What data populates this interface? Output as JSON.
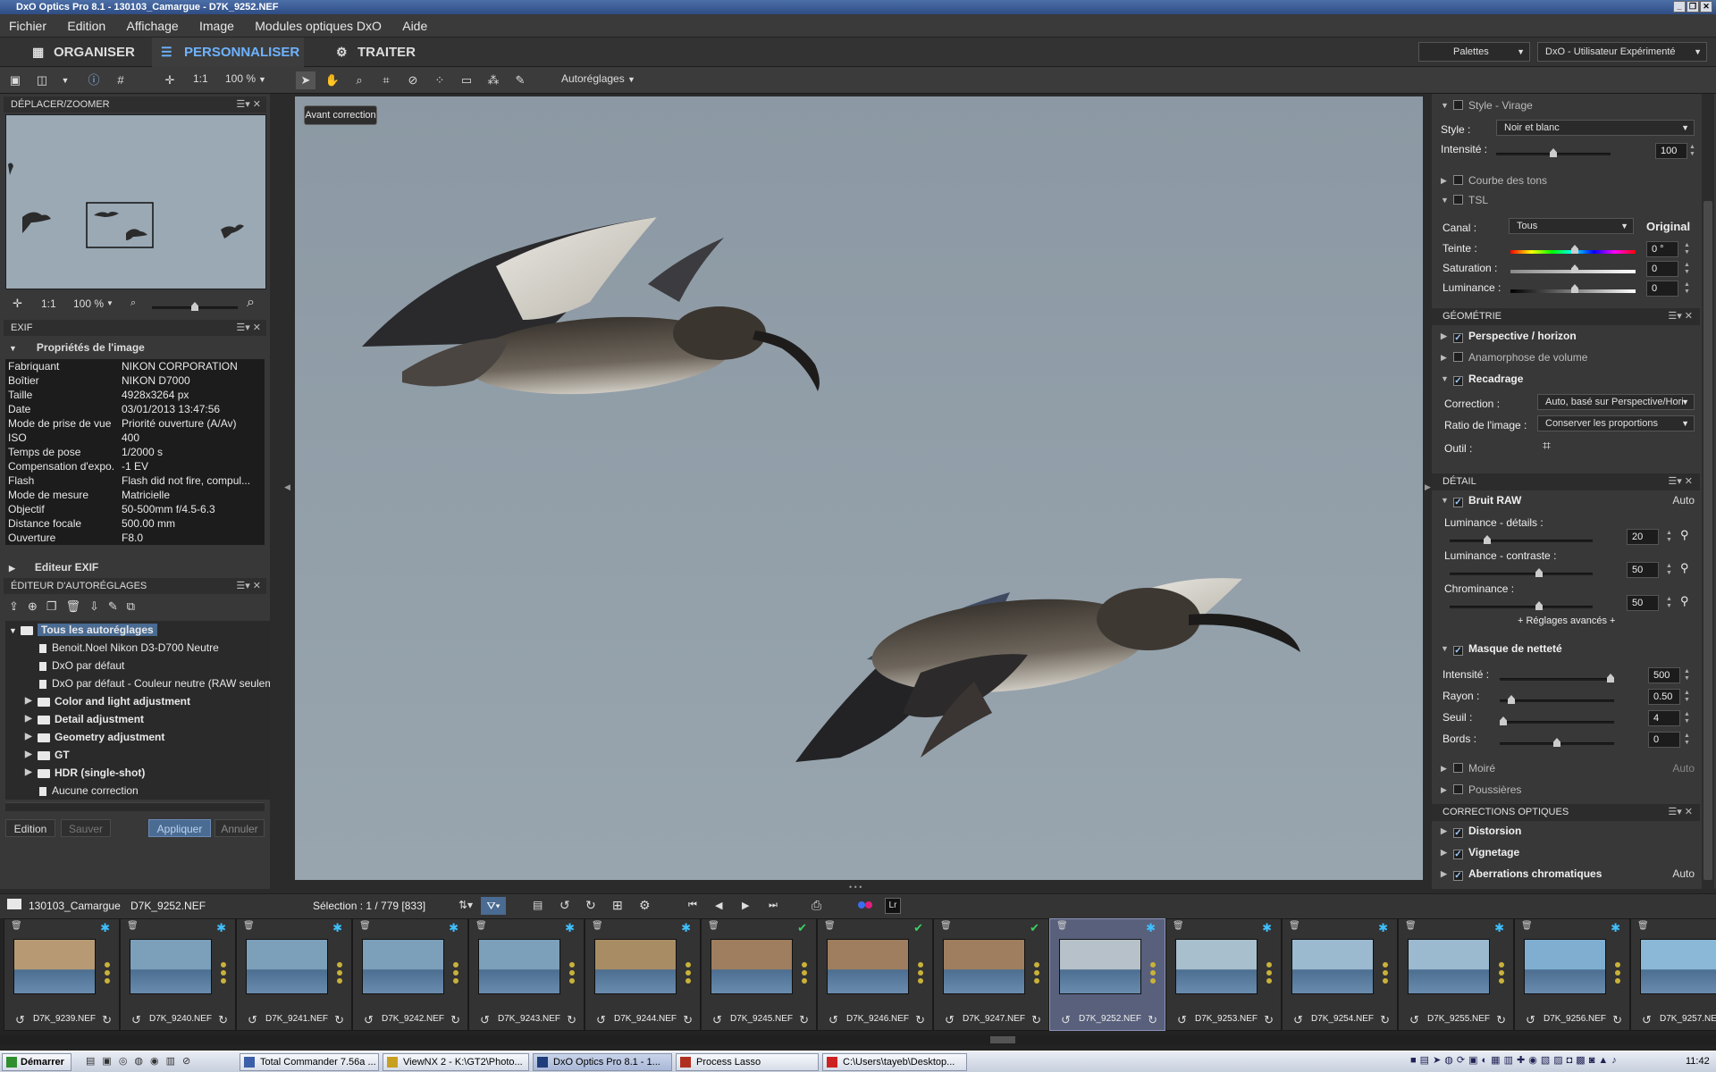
{
  "window": {
    "title": "DxO Optics Pro 8.1 - 130103_Camargue - D7K_9252.NEF"
  },
  "menu": [
    "Fichier",
    "Edition",
    "Affichage",
    "Image",
    "Modules optiques DxO",
    "Aide"
  ],
  "modes": {
    "organize": "ORGANISER",
    "customize": "PERSONNALISER",
    "process": "TRAITER"
  },
  "palettes": {
    "label": "Palettes",
    "workspace": "DxO - Utilisateur Expérimenté"
  },
  "toolbar": {
    "one_to_one": "1:1",
    "zoom": "100 %",
    "presets": "Autoréglages"
  },
  "viewer": {
    "before_button": "Avant correction"
  },
  "move_zoom": {
    "title": "DÉPLACER/ZOOMER",
    "one_to_one": "1:1",
    "zoom": "100 %"
  },
  "exif": {
    "title": "EXIF",
    "section": "Propriétés de l'image",
    "rows": [
      {
        "k": "Fabriquant",
        "v": "NIKON CORPORATION"
      },
      {
        "k": "Boîtier",
        "v": "NIKON D7000"
      },
      {
        "k": "Taille",
        "v": "4928x3264 px"
      },
      {
        "k": "Date",
        "v": "03/01/2013 13:47:56"
      },
      {
        "k": "Mode de prise de vue",
        "v": "Priorité ouverture (A/Av)"
      },
      {
        "k": "ISO",
        "v": "400"
      },
      {
        "k": "Temps de pose",
        "v": "1/2000 s"
      },
      {
        "k": "Compensation d'expo.",
        "v": "-1 EV"
      },
      {
        "k": "Flash",
        "v": "Flash did not fire, compul..."
      },
      {
        "k": "Mode de mesure",
        "v": "Matricielle"
      },
      {
        "k": "Objectif",
        "v": "50-500mm f/4.5-6.3"
      },
      {
        "k": "Distance focale",
        "v": "500.00 mm"
      },
      {
        "k": "Ouverture",
        "v": "F8.0"
      }
    ],
    "editor": "Editeur EXIF"
  },
  "presets_editor": {
    "title": "ÉDITEUR D'AUTORÉGLAGES",
    "root": "Tous les autoréglages",
    "items": [
      {
        "label": "Benoit.Noel Nikon D3-D700 Neutre",
        "type": "doc",
        "bold": false
      },
      {
        "label": "DxO par défaut",
        "type": "doc",
        "bold": false
      },
      {
        "label": "DxO par défaut - Couleur neutre (RAW seulem",
        "type": "doc",
        "bold": false
      },
      {
        "label": "Color and light adjustment",
        "type": "folder",
        "bold": true
      },
      {
        "label": "Detail adjustment",
        "type": "folder",
        "bold": true
      },
      {
        "label": "Geometry adjustment",
        "type": "folder",
        "bold": true
      },
      {
        "label": "GT",
        "type": "folder",
        "bold": true
      },
      {
        "label": "HDR (single-shot)",
        "type": "folder",
        "bold": true
      },
      {
        "label": "Aucune correction",
        "type": "doc",
        "bold": false
      }
    ],
    "buttons": {
      "edit": "Edition",
      "save": "Sauver",
      "apply": "Appliquer",
      "cancel": "Annuler"
    }
  },
  "right": {
    "style_virage": "Style - Virage",
    "style_label": "Style :",
    "style_value": "Noir et blanc",
    "intensity_label": "Intensité :",
    "intensity_value": "100",
    "tone_curve": "Courbe des tons",
    "tsl": "TSL",
    "channel_label": "Canal :",
    "channel_value": "Tous",
    "original": "Original",
    "hue_label": "Teinte :",
    "hue_value": "0 °",
    "sat_label": "Saturation :",
    "sat_value": "0",
    "lum_label": "Luminance :",
    "lum_value": "0",
    "geometry": "GÉOMÉTRIE",
    "perspective": "Perspective / horizon",
    "anamorphosis": "Anamorphose de volume",
    "crop": "Recadrage",
    "correction_label": "Correction :",
    "correction_value": "Auto, basé sur Perspective/Hori",
    "ratio_label": "Ratio de l'image :",
    "ratio_value": "Conserver les proportions",
    "tool_label": "Outil :",
    "detail": "DÉTAIL",
    "raw_noise": "Bruit RAW",
    "auto": "Auto",
    "lum_detail_label": "Luminance - détails :",
    "lum_detail_value": "20",
    "lum_contrast_label": "Luminance - contraste :",
    "lum_contrast_value": "50",
    "chroma_label": "Chrominance :",
    "chroma_value": "50",
    "advanced": "+ Réglages avancés +",
    "unsharp": "Masque de netteté",
    "us_int_label": "Intensité :",
    "us_int_value": "500",
    "radius_label": "Rayon :",
    "radius_value": "0.50",
    "threshold_label": "Seuil :",
    "threshold_value": "4",
    "edges_label": "Bords :",
    "edges_value": "0",
    "moire": "Moiré",
    "dust": "Poussières",
    "optical": "CORRECTIONS OPTIQUES",
    "distortion": "Distorsion",
    "vignetting": "Vignetage",
    "chromatic": "Aberrations chromatiques"
  },
  "status": {
    "folder": "130103_Camargue",
    "file": "D7K_9252.NEF",
    "selection": "Sélection : 1 / 779 [833]",
    "lr": "Lr"
  },
  "filmstrip": [
    {
      "name": "D7K_9239.NEF",
      "mark": "star",
      "tone": "#b79a74"
    },
    {
      "name": "D7K_9240.NEF",
      "mark": "star",
      "tone": "#7c9fba"
    },
    {
      "name": "D7K_9241.NEF",
      "mark": "star",
      "tone": "#7c9fba"
    },
    {
      "name": "D7K_9242.NEF",
      "mark": "star",
      "tone": "#7c9fba"
    },
    {
      "name": "D7K_9243.NEF",
      "mark": "star",
      "tone": "#7c9fba"
    },
    {
      "name": "D7K_9244.NEF",
      "mark": "star",
      "tone": "#a88d64"
    },
    {
      "name": "D7K_9245.NEF",
      "mark": "check",
      "tone": "#9e7e5e"
    },
    {
      "name": "D7K_9246.NEF",
      "mark": "check",
      "tone": "#9e7e5e"
    },
    {
      "name": "D7K_9247.NEF",
      "mark": "check",
      "tone": "#9e7e5e"
    },
    {
      "name": "D7K_9252.NEF",
      "mark": "star",
      "tone": "#b6c1c9"
    },
    {
      "name": "D7K_9253.NEF",
      "mark": "star",
      "tone": "#a8bfcd"
    },
    {
      "name": "D7K_9254.NEF",
      "mark": "star",
      "tone": "#9bbad0"
    },
    {
      "name": "D7K_9255.NEF",
      "mark": "star",
      "tone": "#9bbad0"
    },
    {
      "name": "D7K_9256.NEF",
      "mark": "star",
      "tone": "#7faed0"
    },
    {
      "name": "D7K_9257.NEF",
      "mark": "none",
      "tone": "#8ab8d6"
    }
  ],
  "taskbar": {
    "start": "Démarrer",
    "windows": [
      "Total Commander 7.56a ...",
      "ViewNX 2 - K:\\GT2\\Photo...",
      "DxO Optics Pro 8.1 - 1...",
      "Process Lasso",
      "C:\\Users\\tayeb\\Desktop..."
    ],
    "clock": "11:42"
  }
}
